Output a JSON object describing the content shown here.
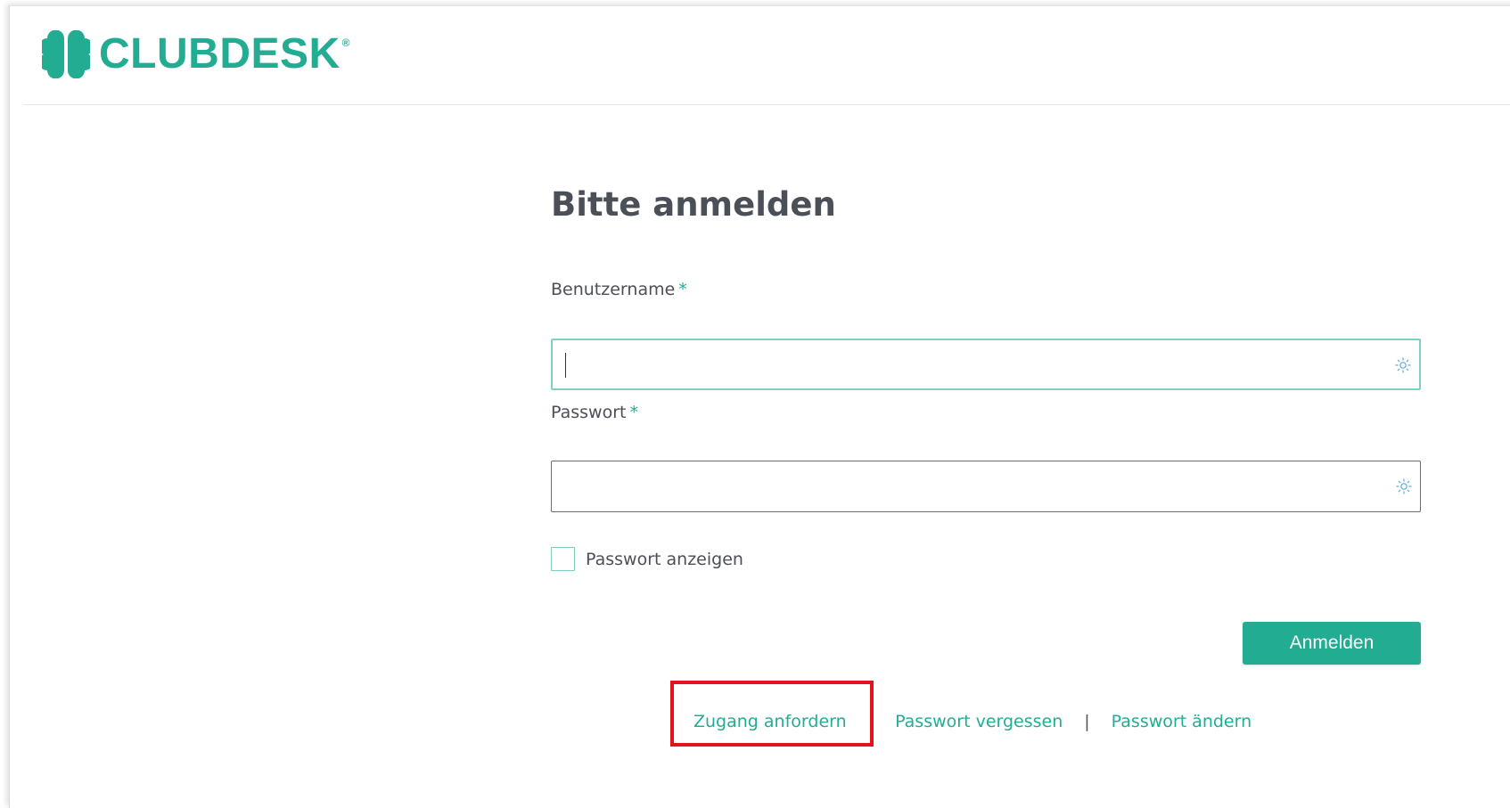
{
  "brand": {
    "name": "CLUBDESK",
    "reg_mark": "®",
    "color": "#22ad93"
  },
  "login": {
    "title": "Bitte anmelden",
    "username": {
      "label": "Benutzername",
      "required_mark": "*",
      "value": "",
      "icon": "key-generator-icon"
    },
    "password": {
      "label": "Passwort",
      "required_mark": "*",
      "value": "",
      "icon": "key-generator-icon"
    },
    "show_password": {
      "label": "Passwort anzeigen",
      "checked": false
    },
    "submit_label": "Anmelden"
  },
  "links": {
    "request_access": "Zugang anfordern",
    "forgot_password": "Passwort vergessen",
    "change_password": "Passwort ändern",
    "separator": "|"
  },
  "annotation": {
    "highlight_color": "#e1141d",
    "highlighted": "request_access"
  }
}
